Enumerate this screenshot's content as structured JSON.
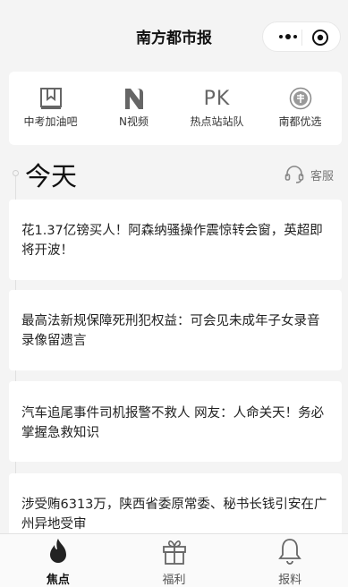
{
  "header": {
    "title": "南方都市报"
  },
  "quick_links": [
    {
      "label": "中考加油吧",
      "icon": "book-icon"
    },
    {
      "label": "N视频",
      "icon": "n-video-logo-icon"
    },
    {
      "label": "热点站站队",
      "icon": "pk-icon",
      "glyph": "PK"
    },
    {
      "label": "南都优选",
      "icon": "nandu-seal-icon"
    }
  ],
  "section": {
    "title": "今天",
    "service_label": "客服"
  },
  "articles": [
    {
      "title": "花1.37亿镑买人！阿森纳骚操作震惊转会窗，英超即将开波！"
    },
    {
      "title": "最高法新规保障死刑犯权益：可会见未成年子女录音录像留遗言"
    },
    {
      "title": "汽车追尾事件司机报警不救人 网友：人命关天！务必掌握急救知识"
    },
    {
      "title": "涉受贿6313万，陕西省委原常委、秘书长钱引安在广州异地受审"
    }
  ],
  "tabbar": [
    {
      "label": "焦点",
      "icon": "flame-icon",
      "active": true
    },
    {
      "label": "福利",
      "icon": "gift-icon",
      "active": false
    },
    {
      "label": "报料",
      "icon": "bell-icon",
      "active": false
    }
  ]
}
